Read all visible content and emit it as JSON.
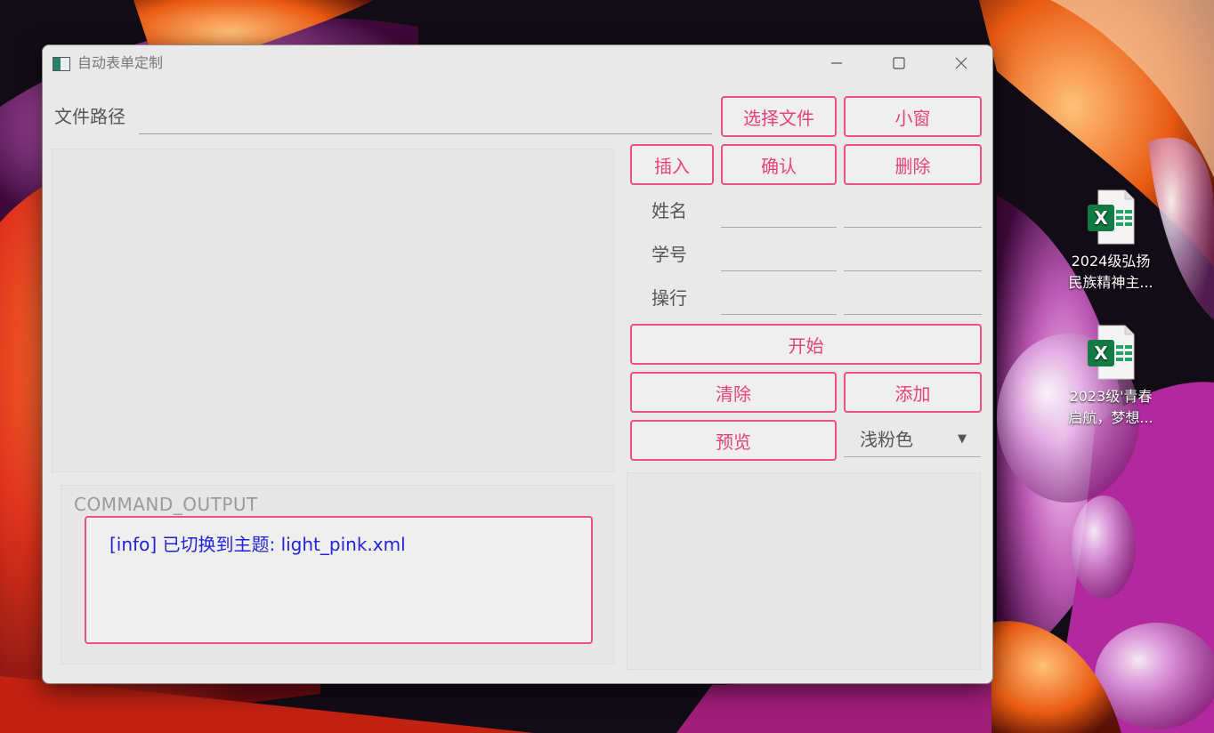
{
  "desktop": {
    "icons": [
      {
        "name": "2024级弘扬民族精神主...",
        "line1": "2024级弘扬",
        "line2": "民族精神主...",
        "icon": "excel-icon"
      },
      {
        "name": "2023级'青春启航，梦想...",
        "line1": "2023级'青春",
        "line2": "启航，梦想...",
        "icon": "excel-icon"
      }
    ],
    "excel_badge": "X"
  },
  "window": {
    "title": "自动表单定制",
    "controls": [
      "minimize-icon",
      "maximize-icon",
      "close-icon"
    ]
  },
  "file": {
    "label": "文件路径",
    "value": "",
    "select_button": "选择文件",
    "mini_button": "小窗"
  },
  "actions": {
    "insert": "插入",
    "confirm": "确认",
    "delete": "删除"
  },
  "fields": [
    {
      "label": "姓名",
      "value1": "",
      "value2": ""
    },
    {
      "label": "学号",
      "value1": "",
      "value2": ""
    },
    {
      "label": "操行",
      "value1": "",
      "value2": ""
    }
  ],
  "controls": {
    "start": "开始",
    "clear": "清除",
    "add": "添加",
    "preview": "预览",
    "theme_selected": "浅粉色",
    "dropdown_arrow": "▼"
  },
  "command_output": {
    "title": "COMMAND_OUTPUT",
    "line": "[info] 已切换到主题: light_pink.xml"
  },
  "colors": {
    "accent": "#ec4f84",
    "accent_text": "#e9407b",
    "window_bg": "#e9e9e9",
    "output_text": "#2222dd"
  }
}
